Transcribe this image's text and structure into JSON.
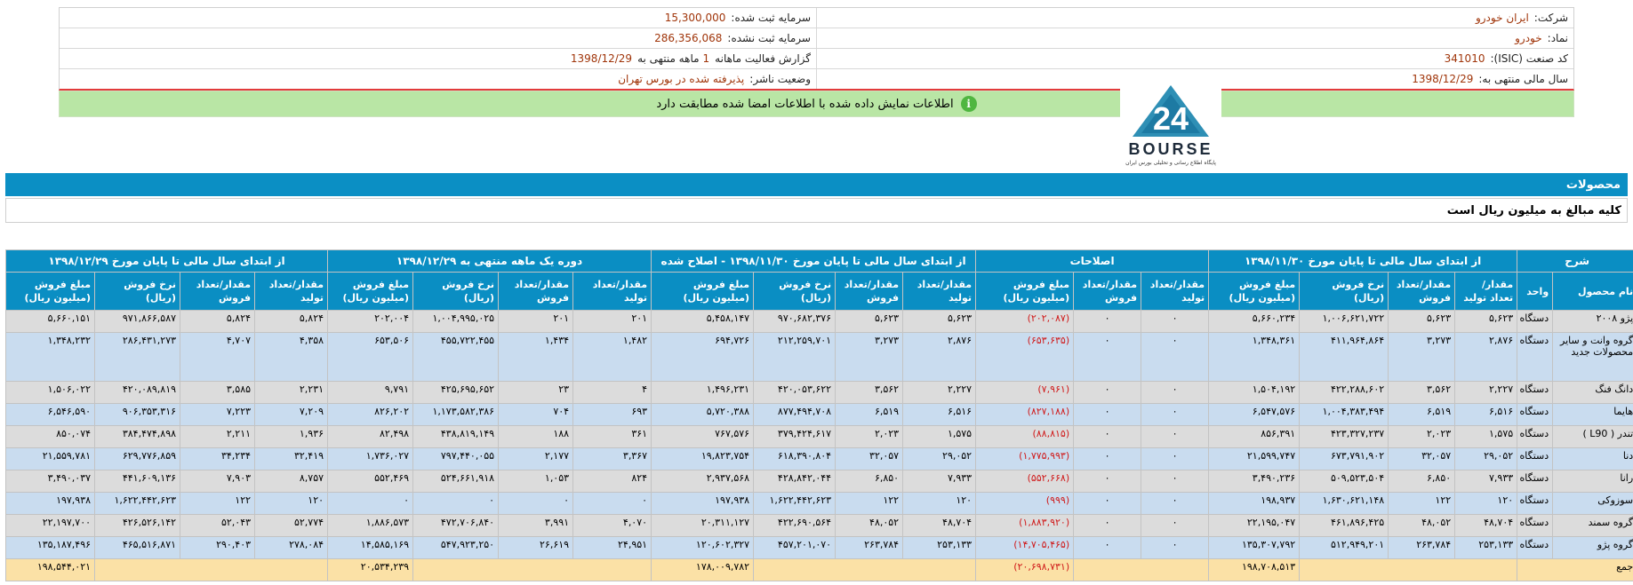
{
  "header": {
    "company_label": "شرکت:",
    "company_value": "ایران خودرو",
    "symbol_label": "نماد:",
    "symbol_value": "خودرو",
    "isic_label": "کد صنعت (ISIC):",
    "isic_value": "341010",
    "fiscal_label": "سال مالی منتهی به:",
    "fiscal_value": "1398/12/29",
    "capital_label": "سرمایه ثبت شده:",
    "capital_value": "15,300,000",
    "unreg_capital_label": "سرمایه ثبت نشده:",
    "unreg_capital_value": "286,356,068",
    "report_label": "گزارش فعالیت ماهانه",
    "report_months": "1",
    "report_mid": "ماهه منتهی به",
    "report_date": "1398/12/29",
    "status_label": "وضعیت ناشر:",
    "status_value": "پذیرفته شده در بورس تهران"
  },
  "notice": {
    "text": "اطلاعات نمایش داده شده با اطلاعات امضا شده مطابقت دارد",
    "icon": "info-icon",
    "color": "#b9e6a5"
  },
  "logo": {
    "word": "BOURSE",
    "tagline": "پایگاه اطلاع رسانی و تحلیلی بورس ایران",
    "number": "24"
  },
  "section": {
    "title": "محصولات",
    "note": "کلیه مبالغ به میلیون ریال است"
  },
  "table": {
    "group_headers": [
      "شرح",
      "از ابتدای سال مالی تا پایان مورخ ۱۳۹۸/۱۱/۳۰",
      "اصلاحات",
      "از ابتدای سال مالی تا پایان مورخ ۱۳۹۸/۱۱/۳۰ - اصلاح شده",
      "دوره یک ماهه منتهی به ۱۳۹۸/۱۲/۲۹",
      "از ابتدای سال مالی تا پایان مورخ ۱۳۹۸/۱۲/۲۹"
    ],
    "sub_headers": {
      "product": "نام محصول",
      "unit": "واحد",
      "prod_qty": "مقدار/تعداد تولید",
      "sale_qty": "مقدار/تعداد فروش",
      "rate": "نرخ فروش (ریال)",
      "amount": "مبلغ فروش (میلیون ریال)"
    },
    "rows": [
      {
        "name": "پژو ۲۰۰۸",
        "unit": "دستگاه",
        "c": [
          "۵,۶۲۳",
          "۵,۶۲۳",
          "۱,۰۰۶,۶۲۱,۷۲۲",
          "۵,۶۶۰,۲۳۴",
          "۰",
          "۰",
          "(۲۰۲,۰۸۷)",
          "۵,۶۲۳",
          "۵,۶۲۳",
          "۹۷۰,۶۸۲,۳۷۶",
          "۵,۴۵۸,۱۴۷",
          "۲۰۱",
          "۲۰۱",
          "۱,۰۰۴,۹۹۵,۰۲۵",
          "۲۰۲,۰۰۴",
          "۵,۸۲۴",
          "۵,۸۲۴",
          "۹۷۱,۸۶۶,۵۸۷",
          "۵,۶۶۰,۱۵۱"
        ]
      },
      {
        "name": "گروه وانت و سایر محصولات جدید",
        "unit": "دستگاه",
        "c": [
          "۲,۸۷۶",
          "۳,۲۷۳",
          "۴۱۱,۹۶۴,۸۶۴",
          "۱,۳۴۸,۳۶۱",
          "۰",
          "۰",
          "(۶۵۳,۶۳۵)",
          "۲,۸۷۶",
          "۳,۲۷۳",
          "۲۱۲,۲۵۹,۷۰۱",
          "۶۹۴,۷۲۶",
          "۱,۴۸۲",
          "۱,۴۳۴",
          "۴۵۵,۷۲۲,۴۵۵",
          "۶۵۳,۵۰۶",
          "۴,۳۵۸",
          "۴,۷۰۷",
          "۲۸۶,۴۳۱,۲۷۳",
          "۱,۳۴۸,۲۳۲"
        ]
      },
      {
        "name": "دانگ فنگ",
        "unit": "دستگاه",
        "c": [
          "۲,۲۲۷",
          "۳,۵۶۲",
          "۴۲۲,۲۸۸,۶۰۲",
          "۱,۵۰۴,۱۹۲",
          "۰",
          "۰",
          "(۷,۹۶۱)",
          "۲,۲۲۷",
          "۳,۵۶۲",
          "۴۲۰,۰۵۳,۶۲۲",
          "۱,۴۹۶,۲۳۱",
          "۴",
          "۲۳",
          "۴۲۵,۶۹۵,۶۵۲",
          "۹,۷۹۱",
          "۲,۲۳۱",
          "۳,۵۸۵",
          "۴۲۰,۰۸۹,۸۱۹",
          "۱,۵۰۶,۰۲۲"
        ]
      },
      {
        "name": "هایما",
        "unit": "دستگاه",
        "c": [
          "۶,۵۱۶",
          "۶,۵۱۹",
          "۱,۰۰۴,۳۸۳,۴۹۴",
          "۶,۵۴۷,۵۷۶",
          "۰",
          "۰",
          "(۸۲۷,۱۸۸)",
          "۶,۵۱۶",
          "۶,۵۱۹",
          "۸۷۷,۴۹۴,۷۰۸",
          "۵,۷۲۰,۳۸۸",
          "۶۹۳",
          "۷۰۴",
          "۱,۱۷۳,۵۸۲,۳۸۶",
          "۸۲۶,۲۰۲",
          "۷,۲۰۹",
          "۷,۲۲۳",
          "۹۰۶,۳۵۳,۳۱۶",
          "۶,۵۴۶,۵۹۰"
        ]
      },
      {
        "name": "تندر ( L90 )",
        "unit": "دستگاه",
        "c": [
          "۱,۵۷۵",
          "۲,۰۲۳",
          "۴۲۳,۳۲۷,۲۳۷",
          "۸۵۶,۳۹۱",
          "۰",
          "۰",
          "(۸۸,۸۱۵)",
          "۱,۵۷۵",
          "۲,۰۲۳",
          "۳۷۹,۴۲۴,۶۱۷",
          "۷۶۷,۵۷۶",
          "۳۶۱",
          "۱۸۸",
          "۴۳۸,۸۱۹,۱۴۹",
          "۸۲,۴۹۸",
          "۱,۹۳۶",
          "۲,۲۱۱",
          "۳۸۴,۴۷۴,۸۹۸",
          "۸۵۰,۰۷۴"
        ]
      },
      {
        "name": "دنا",
        "unit": "دستگاه",
        "c": [
          "۲۹,۰۵۲",
          "۳۲,۰۵۷",
          "۶۷۳,۷۹۱,۹۰۲",
          "۲۱,۵۹۹,۷۴۷",
          "۰",
          "۰",
          "(۱,۷۷۵,۹۹۳)",
          "۲۹,۰۵۲",
          "۳۲,۰۵۷",
          "۶۱۸,۳۹۰,۸۰۴",
          "۱۹,۸۲۳,۷۵۴",
          "۳,۳۶۷",
          "۲,۱۷۷",
          "۷۹۷,۴۴۰,۰۵۵",
          "۱,۷۳۶,۰۲۷",
          "۳۲,۴۱۹",
          "۳۴,۲۳۴",
          "۶۲۹,۷۷۶,۸۵۹",
          "۲۱,۵۵۹,۷۸۱"
        ]
      },
      {
        "name": "رانا",
        "unit": "دستگاه",
        "c": [
          "۷,۹۳۳",
          "۶,۸۵۰",
          "۵۰۹,۵۲۳,۵۰۴",
          "۳,۴۹۰,۲۳۶",
          "۰",
          "۰",
          "(۵۵۲,۶۶۸)",
          "۷,۹۳۳",
          "۶,۸۵۰",
          "۴۲۸,۸۴۲,۰۴۴",
          "۲,۹۳۷,۵۶۸",
          "۸۲۴",
          "۱,۰۵۳",
          "۵۲۴,۶۶۱,۹۱۸",
          "۵۵۲,۴۶۹",
          "۸,۷۵۷",
          "۷,۹۰۳",
          "۴۴۱,۶۰۹,۱۳۶",
          "۳,۴۹۰,۰۳۷"
        ]
      },
      {
        "name": "سوزوکی",
        "unit": "دستگاه",
        "c": [
          "۱۲۰",
          "۱۲۲",
          "۱,۶۳۰,۶۲۱,۱۴۸",
          "۱۹۸,۹۳۷",
          "۰",
          "۰",
          "(۹۹۹)",
          "۱۲۰",
          "۱۲۲",
          "۱,۶۲۲,۴۴۲,۶۲۳",
          "۱۹۷,۹۳۸",
          "۰",
          "۰",
          "۰",
          "۰",
          "۱۲۰",
          "۱۲۲",
          "۱,۶۲۲,۴۴۲,۶۲۳",
          "۱۹۷,۹۳۸"
        ]
      },
      {
        "name": "گروه سمند",
        "unit": "دستگاه",
        "c": [
          "۴۸,۷۰۴",
          "۴۸,۰۵۲",
          "۴۶۱,۸۹۶,۴۲۵",
          "۲۲,۱۹۵,۰۴۷",
          "۰",
          "۰",
          "(۱,۸۸۳,۹۲۰)",
          "۴۸,۷۰۴",
          "۴۸,۰۵۲",
          "۴۲۲,۶۹۰,۵۶۴",
          "۲۰,۳۱۱,۱۲۷",
          "۴,۰۷۰",
          "۳,۹۹۱",
          "۴۷۲,۷۰۶,۸۴۰",
          "۱,۸۸۶,۵۷۳",
          "۵۲,۷۷۴",
          "۵۲,۰۴۳",
          "۴۲۶,۵۲۶,۱۴۲",
          "۲۲,۱۹۷,۷۰۰"
        ]
      },
      {
        "name": "گروه پژو",
        "unit": "دستگاه",
        "c": [
          "۲۵۳,۱۳۳",
          "۲۶۳,۷۸۴",
          "۵۱۲,۹۴۹,۲۰۱",
          "۱۳۵,۳۰۷,۷۹۲",
          "۰",
          "۰",
          "(۱۴,۷۰۵,۴۶۵)",
          "۲۵۳,۱۳۳",
          "۲۶۳,۷۸۴",
          "۴۵۷,۲۰۱,۰۷۰",
          "۱۲۰,۶۰۲,۳۲۷",
          "۲۴,۹۵۱",
          "۲۶,۶۱۹",
          "۵۴۷,۹۲۳,۲۵۰",
          "۱۴,۵۸۵,۱۶۹",
          "۲۷۸,۰۸۴",
          "۲۹۰,۴۰۳",
          "۴۶۵,۵۱۶,۸۷۱",
          "۱۳۵,۱۸۷,۴۹۶"
        ]
      }
    ],
    "total": {
      "label": "جمع",
      "amount_1": "۱۹۸,۷۰۸,۵۱۳",
      "adjust": "(۲۰,۶۹۸,۷۳۱)",
      "amount_2": "۱۷۸,۰۰۹,۷۸۲",
      "amount_3": "۲۰,۵۳۴,۲۳۹",
      "amount_4": "۱۹۸,۵۴۴,۰۲۱"
    }
  }
}
